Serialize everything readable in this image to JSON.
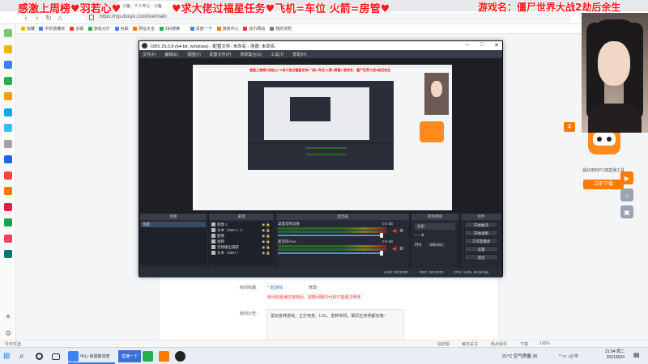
{
  "overlay": {
    "top_left": "感激上周榜♥羽若心♥",
    "top_mid": "♥求大佬过福星任务♥飞机=车位 火箭=房管♥",
    "top_right": "游戏名：僵尸世界大战2劫后余生"
  },
  "browser": {
    "tab_title": "斗鱼 - 个人中心 - 斗鱼",
    "url": "https://mp.douyu.com/live/main",
    "back": "‹",
    "forward": "›",
    "refresh": "↻",
    "home": "⌂",
    "bookmarks": [
      "收藏",
      "手机收藏夹",
      "谷歌",
      "游戏大厅",
      "谷歌",
      "网址大全",
      "360搜索",
      "百度一下",
      "游戏中心",
      "比价网站",
      "我的货柜"
    ],
    "status_left": "今日优选",
    "status_items": [
      "快剪辑",
      "每日关注",
      "热点资讯",
      "下载",
      "100%"
    ]
  },
  "page": {
    "title_label": "房间标题：",
    "title_value": "一起游戏",
    "modify": "修改",
    "notice": "房间标题通过审核后，需要间隔10分钟才能再次修改",
    "announce_label": "房间公告：",
    "announce_text": "雷玩各种游戏，主打电竞、LOL、各种单机，联机生存类都玩哦~"
  },
  "ad": {
    "caption": "最好用的PC端直播工具",
    "button": "立即下载",
    "badge": "4"
  },
  "right_buttons": [
    {
      "icon": "play-icon",
      "glyph": "▶",
      "color": "#ff7a00"
    },
    {
      "icon": "home-icon",
      "glyph": "⌂",
      "color": "#9aa4b2"
    },
    {
      "icon": "app-icon",
      "glyph": "▣",
      "color": "#9aa4b2"
    }
  ],
  "obs": {
    "title": "OBS 25.0.8 (64-bit, windows) - 配置文件: 未命名 - 场景: 未命名",
    "min": "–",
    "max": "□",
    "close": "✕",
    "menu": [
      "文件(F)",
      "编辑(E)",
      "视图(V)",
      "配置文件(P)",
      "场景集合(S)",
      "工具(T)",
      "帮助(H)"
    ],
    "docks": {
      "scenes": "场景",
      "sources": "来源",
      "mixer": "混音器",
      "transitions": "转场特效",
      "controls": "控件"
    },
    "scene_items": [
      "场景"
    ],
    "source_items": [
      "图像 2",
      "文本（GDI+）2",
      "图像",
      "视频",
      "音频输出捕获",
      "文本（GDI+）"
    ],
    "mixer": [
      {
        "name": "桌面音频设备",
        "db": "0.0 dB"
      },
      {
        "name": "麦克风/Aux",
        "db": "0.0 dB"
      }
    ],
    "transition": "淡出",
    "duration_label": "时长",
    "duration_value": "300 ms",
    "controls": [
      "开始推流",
      "开始录制",
      "工作室模式",
      "设置",
      "退出"
    ],
    "status": [
      "LIVE: 00:00:00",
      "REC: 00:00:00",
      "CPU: 1.9%, 60.00 fps"
    ],
    "foot": "+ − ∧ ∨"
  },
  "taskbar": {
    "start": "⊞",
    "search": "⌕",
    "items": [
      "中心·体验新浏览",
      "直播一下"
    ],
    "weather": "21°C 空气质量 26",
    "time": "21:04 周二",
    "date": "2021/8/24"
  },
  "colors": {
    "overlay_red": "#ff1a1a",
    "obs_bg": "#2b2e38",
    "accent_orange": "#ff7a00",
    "link_blue": "#3b6fd6"
  }
}
